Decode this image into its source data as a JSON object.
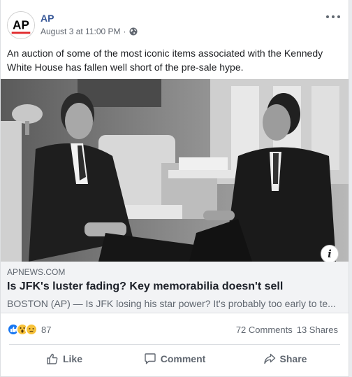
{
  "post": {
    "page_name": "AP",
    "avatar_text": "AP",
    "timestamp": "August 3 at 11:00 PM",
    "separator": "·",
    "audience_icon": "globe-icon",
    "text": "An auction of some of the most iconic items associated with the Kennedy White House has fallen well short of the pre-sale hype."
  },
  "link": {
    "domain": "APNEWS.COM",
    "title": "Is JFK's luster fading? Key memorabilia doesn't sell",
    "description": "BOSTON (AP) — Is JFK losing his star power? It's probably too early to te...",
    "info_icon": "i"
  },
  "engagement": {
    "reaction_icons": [
      "like-reaction",
      "wow-reaction",
      "sad-reaction"
    ],
    "reaction_count": "87",
    "comments": "72 Comments",
    "shares": "13 Shares"
  },
  "actions": {
    "like": "Like",
    "comment": "Comment",
    "share": "Share"
  },
  "colors": {
    "link_blue": "#385898",
    "meta_gray": "#606770",
    "ap_red": "#e0282b",
    "like_blue": "#1877f2",
    "emoji_yellow": "#f7c23a"
  }
}
